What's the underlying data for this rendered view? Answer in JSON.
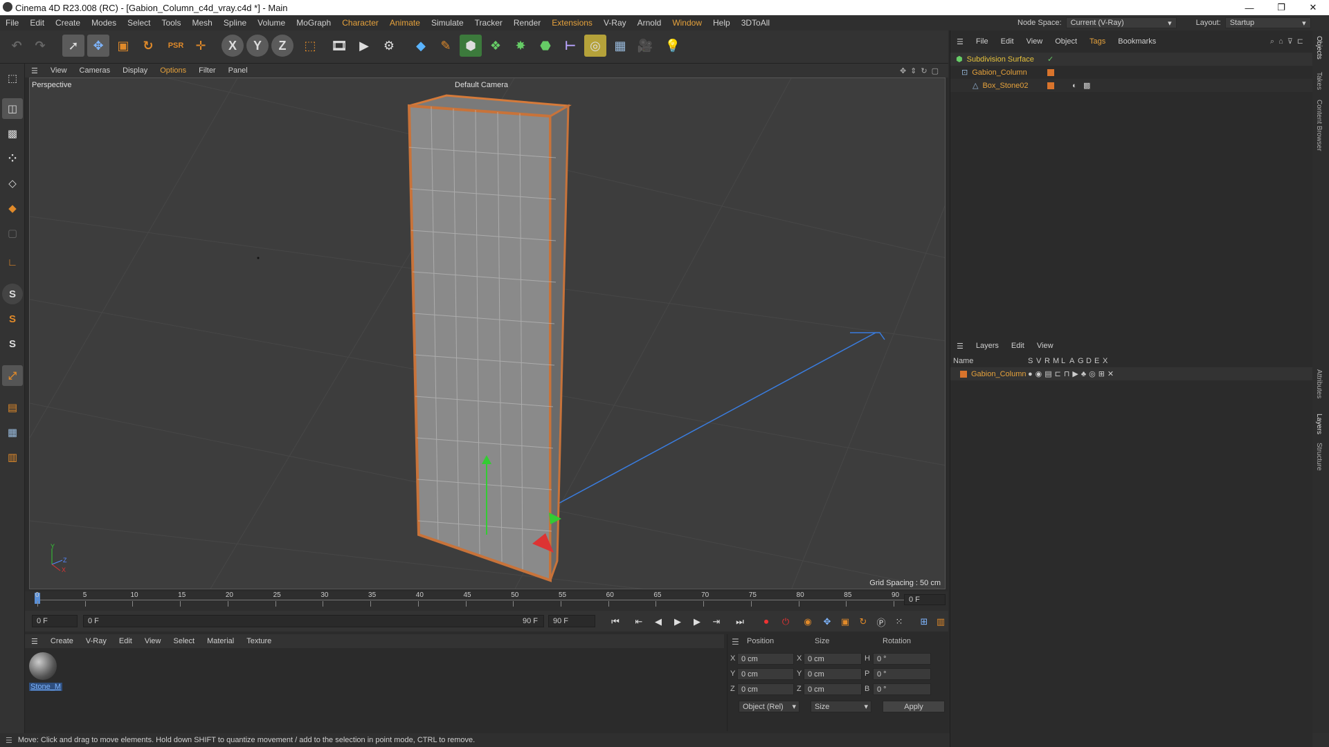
{
  "title": "Cinema 4D R23.008 (RC) - [Gabion_Column_c4d_vray.c4d *] - Main",
  "window_controls": {
    "minimize": "—",
    "restore": "❐",
    "close": "✕"
  },
  "menu": [
    "File",
    "Edit",
    "Create",
    "Modes",
    "Select",
    "Tools",
    "Mesh",
    "Spline",
    "Volume",
    "MoGraph",
    "Character",
    "Animate",
    "Simulate",
    "Tracker",
    "Render",
    "Extensions",
    "V-Ray",
    "Arnold",
    "Window",
    "Help",
    "3DToAll"
  ],
  "node_space": {
    "label": "Node Space:",
    "value": "Current (V-Ray)"
  },
  "layout": {
    "label": "Layout:",
    "value": "Startup"
  },
  "toolbar": {
    "x": "X",
    "y": "Y",
    "z": "Z"
  },
  "viewport": {
    "menu": [
      "View",
      "Cameras",
      "Display",
      "Options",
      "Filter",
      "Panel"
    ],
    "mode_label": "Perspective",
    "camera_label": "Default Camera",
    "grid_spacing": "Grid Spacing : 50 cm",
    "axis_y": "Y",
    "axis_z": "Z",
    "axis_x": "X"
  },
  "timeline": {
    "ticks": [
      "0",
      "5",
      "10",
      "15",
      "20",
      "25",
      "30",
      "35",
      "40",
      "45",
      "50",
      "55",
      "60",
      "65",
      "70",
      "75",
      "80",
      "85",
      "90"
    ],
    "current_frame": "0 F",
    "start_field": "0 F",
    "range_start": "0 F",
    "range_end": "90 F",
    "end_field": "90 F",
    "frame_display": "0 F"
  },
  "material_menu": [
    "Create",
    "V-Ray",
    "Edit",
    "View",
    "Select",
    "Material",
    "Texture"
  ],
  "materials": [
    {
      "name": "Stone_M"
    }
  ],
  "coordinates": {
    "headers": [
      "Position",
      "Size",
      "Rotation"
    ],
    "rows": [
      {
        "axis": "X",
        "pos": "0 cm",
        "size_axis": "X",
        "size": "0 cm",
        "rot_axis": "H",
        "rot": "0 °"
      },
      {
        "axis": "Y",
        "pos": "0 cm",
        "size_axis": "Y",
        "size": "0 cm",
        "rot_axis": "P",
        "rot": "0 °"
      },
      {
        "axis": "Z",
        "pos": "0 cm",
        "size_axis": "Z",
        "size": "0 cm",
        "rot_axis": "B",
        "rot": "0 °"
      }
    ],
    "mode_dropdown": "Object (Rel)",
    "size_dropdown": "Size",
    "apply": "Apply"
  },
  "status": "Move: Click and drag to move elements. Hold down SHIFT to quantize movement / add to the selection in point mode, CTRL to remove.",
  "objects_panel": {
    "menu": [
      "File",
      "Edit",
      "View",
      "Object",
      "Tags",
      "Bookmarks"
    ],
    "items": [
      {
        "name": "Subdivision Surface"
      },
      {
        "name": "Gabion_Column"
      },
      {
        "name": "Box_Stone02"
      }
    ]
  },
  "layers_panel": {
    "menu": [
      "Layers",
      "Edit",
      "View"
    ],
    "columns": [
      "Name",
      "S",
      "V",
      "R",
      "M",
      "L",
      "A",
      "G",
      "D",
      "E",
      "X"
    ],
    "items": [
      {
        "name": "Gabion_Column"
      }
    ]
  },
  "side_tabs": [
    "Objects",
    "Takes",
    "Content Browser",
    "Attributes",
    "Layers",
    "Structure"
  ],
  "colors": {
    "accent": "#e6a23c",
    "layer_orange": "#d9742c",
    "background": "#2b2b2b"
  }
}
